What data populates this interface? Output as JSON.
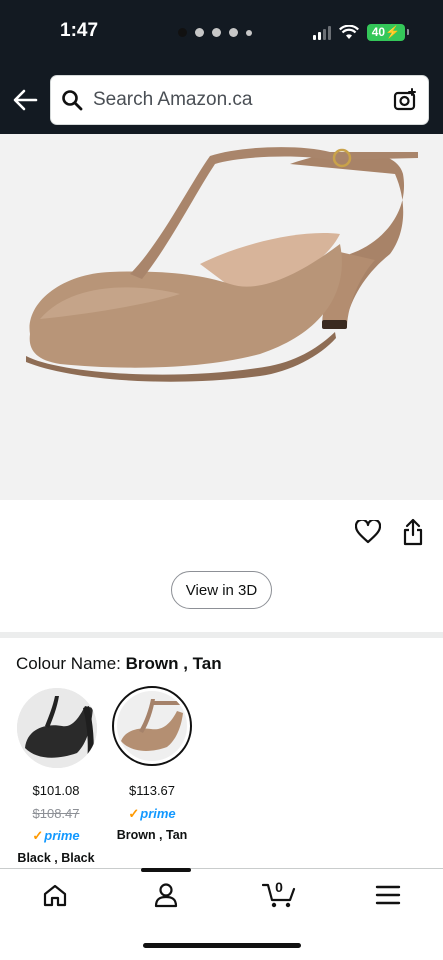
{
  "status_bar": {
    "time": "1:47",
    "battery": "40"
  },
  "search": {
    "placeholder": "Search Amazon.ca"
  },
  "product": {
    "view_3d_label": "View in 3D",
    "carousel_dots": 5,
    "carousel_active": 0
  },
  "colour": {
    "label": "Colour Name: ",
    "selected": "Brown , Tan"
  },
  "variants": [
    {
      "name": "Black , Black",
      "price": "$101.08",
      "list_price": "$108.47",
      "prime": "prime"
    },
    {
      "name": "Brown , Tan",
      "price": "$113.67",
      "list_price": "",
      "prime": "prime"
    }
  ],
  "nav": {
    "cart_count": "0"
  },
  "icons": [
    "back-arrow-icon",
    "search-icon",
    "camera-icon",
    "heart-icon",
    "share-icon",
    "home-icon",
    "account-icon",
    "cart-icon",
    "menu-icon"
  ],
  "colors": {
    "header_bg": "#131a22",
    "battery": "#34c759",
    "prime_blue": "#1399ff",
    "prime_check": "#ff9900"
  }
}
